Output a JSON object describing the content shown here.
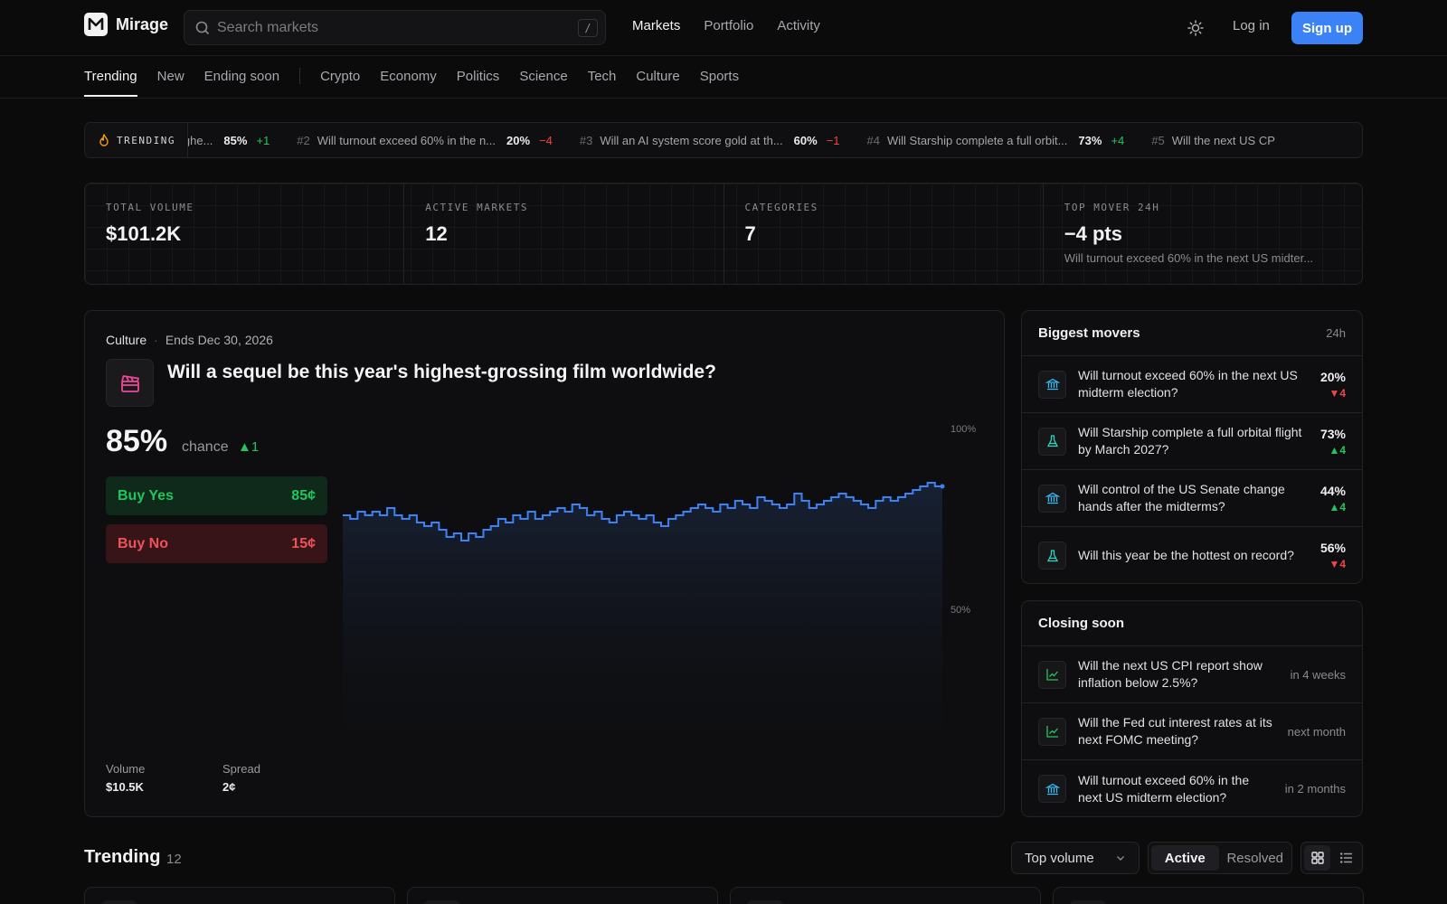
{
  "header": {
    "brand": "Mirage",
    "search_placeholder": "Search markets",
    "search_shortcut": "/",
    "nav": [
      "Markets",
      "Portfolio",
      "Activity"
    ],
    "login": "Log in",
    "signup": "Sign up"
  },
  "categories": {
    "primary": [
      "Trending",
      "New",
      "Ending soon"
    ],
    "topics": [
      "Crypto",
      "Economy",
      "Politics",
      "Science",
      "Tech",
      "Culture",
      "Sports"
    ]
  },
  "ticker": {
    "label": "TRENDING",
    "items": [
      {
        "num": "",
        "text": "ighe...",
        "pct": "85%",
        "delta": "+1",
        "dir": "up"
      },
      {
        "num": "#2",
        "text": "Will turnout exceed 60% in the n...",
        "pct": "20%",
        "delta": "−4",
        "dir": "down"
      },
      {
        "num": "#3",
        "text": "Will an AI system score gold at th...",
        "pct": "60%",
        "delta": "−1",
        "dir": "down"
      },
      {
        "num": "#4",
        "text": "Will Starship complete a full orbit...",
        "pct": "73%",
        "delta": "+4",
        "dir": "up"
      },
      {
        "num": "#5",
        "text": "Will the next US CP",
        "pct": "",
        "delta": "",
        "dir": "up"
      }
    ]
  },
  "stats": [
    {
      "label": "TOTAL VOLUME",
      "value": "$101.2K",
      "sub": ""
    },
    {
      "label": "ACTIVE MARKETS",
      "value": "12",
      "sub": ""
    },
    {
      "label": "CATEGORIES",
      "value": "7",
      "sub": ""
    },
    {
      "label": "TOP MOVER 24H",
      "value": "−4 pts",
      "sub": "Will turnout exceed 60% in the next US midter..."
    }
  ],
  "featured": {
    "category": "Culture",
    "ends": "Ends Dec 30, 2026",
    "title": "Will a sequel be this year's highest-grossing film worldwide?",
    "percent": "85%",
    "chance_label": "chance",
    "delta": "▲1",
    "buy_yes_label": "Buy Yes",
    "buy_yes_price": "85¢",
    "buy_no_label": "Buy No",
    "buy_no_price": "15¢",
    "volume_label": "Volume",
    "volume": "$10.5K",
    "spread_label": "Spread",
    "spread": "2¢",
    "chart_axis_top": "100%",
    "chart_axis_mid": "50%"
  },
  "chart_data": {
    "type": "area",
    "y_ticks": [
      "100%",
      "50%"
    ],
    "ylim": [
      0,
      100
    ],
    "values": [
      77,
      76,
      78,
      77,
      78,
      77,
      79,
      77,
      76,
      77,
      75,
      74,
      75,
      73,
      71,
      72,
      70,
      72,
      71,
      73,
      74,
      76,
      75,
      77,
      76,
      78,
      76,
      77,
      78,
      79,
      78,
      80,
      79,
      77,
      78,
      76,
      75,
      77,
      78,
      77,
      76,
      77,
      75,
      74,
      76,
      77,
      78,
      79,
      80,
      79,
      78,
      80,
      79,
      81,
      80,
      79,
      82,
      81,
      80,
      79,
      80,
      83,
      81,
      79,
      80,
      81,
      82,
      83,
      82,
      81,
      80,
      79,
      81,
      82,
      81,
      82,
      83,
      84,
      85,
      86,
      85
    ]
  },
  "movers": {
    "title": "Biggest movers",
    "period": "24h",
    "items": [
      {
        "text": "Will turnout exceed 60% in the next US midterm election?",
        "pct": "20%",
        "delta": "▼4",
        "dir": "down",
        "icon": "bank-icon"
      },
      {
        "text": "Will Starship complete a full orbital flight by March 2027?",
        "pct": "73%",
        "delta": "▲4",
        "dir": "up",
        "icon": "flask-icon"
      },
      {
        "text": "Will control of the US Senate change hands after the midterms?",
        "pct": "44%",
        "delta": "▲4",
        "dir": "up",
        "icon": "bank-icon"
      },
      {
        "text": "Will this year be the hottest on record?",
        "pct": "56%",
        "delta": "▼4",
        "dir": "down",
        "icon": "flask-icon"
      }
    ]
  },
  "closing": {
    "title": "Closing soon",
    "items": [
      {
        "text": "Will the next US CPI report show inflation below 2.5%?",
        "when": "in 4 weeks",
        "icon": "chart-icon"
      },
      {
        "text": "Will the Fed cut interest rates at its next FOMC meeting?",
        "when": "next month",
        "icon": "chart-icon"
      },
      {
        "text": "Will turnout exceed 60% in the next US midterm election?",
        "when": "in 2 months",
        "icon": "bank-icon"
      }
    ]
  },
  "trending": {
    "title": "Trending",
    "count": "12",
    "sort": "Top volume",
    "filter_active": "Active",
    "filter_resolved": "Resolved"
  },
  "colors": {
    "accent": "#3b82f6",
    "up": "#22c55e",
    "down": "#ef4444",
    "chart_line": "#3b82f6"
  }
}
